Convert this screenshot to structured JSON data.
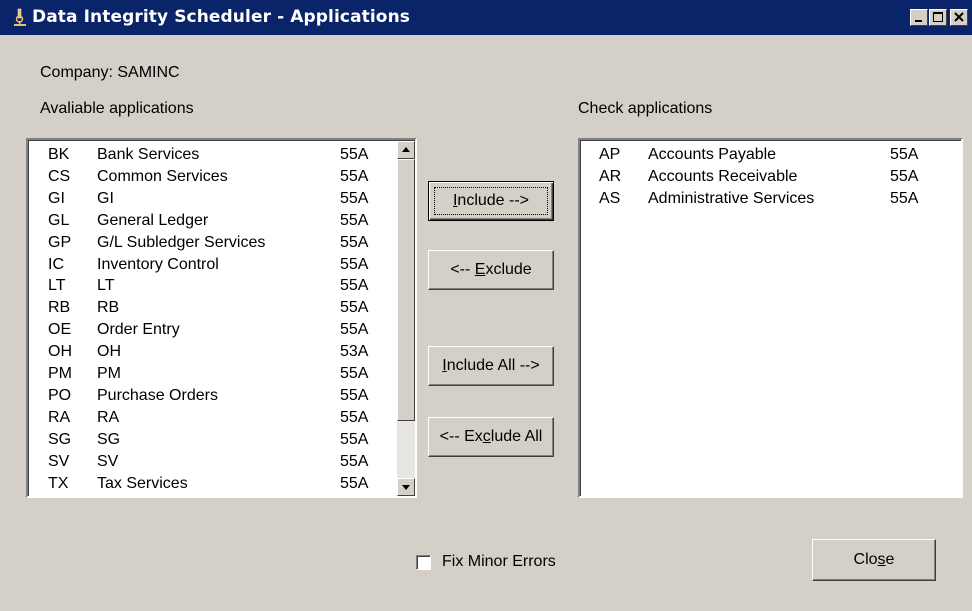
{
  "window": {
    "title": "Data Integrity Scheduler - Applications",
    "minimize_icon": "minimize-icon",
    "maximize_icon": "maximize-icon",
    "close_icon": "close-icon",
    "app_icon": "microscope-icon"
  },
  "company_label": "Company: SAMINC",
  "available": {
    "label": "Avaliable applications",
    "items": [
      {
        "code": "BK",
        "name": "Bank Services",
        "ver": "55A"
      },
      {
        "code": "CS",
        "name": "Common Services",
        "ver": "55A"
      },
      {
        "code": "GI",
        "name": "GI",
        "ver": "55A"
      },
      {
        "code": "GL",
        "name": "General Ledger",
        "ver": "55A"
      },
      {
        "code": "GP",
        "name": "G/L Subledger Services",
        "ver": "55A"
      },
      {
        "code": "IC",
        "name": "Inventory Control",
        "ver": "55A"
      },
      {
        "code": "LT",
        "name": "LT",
        "ver": "55A"
      },
      {
        "code": "RB",
        "name": "RB",
        "ver": "55A"
      },
      {
        "code": "OE",
        "name": "Order Entry",
        "ver": "55A"
      },
      {
        "code": "OH",
        "name": "OH",
        "ver": "53A"
      },
      {
        "code": "PM",
        "name": "PM",
        "ver": "55A"
      },
      {
        "code": "PO",
        "name": "Purchase Orders",
        "ver": "55A"
      },
      {
        "code": "RA",
        "name": "RA",
        "ver": "55A"
      },
      {
        "code": "SG",
        "name": "SG",
        "ver": "55A"
      },
      {
        "code": "SV",
        "name": "SV",
        "ver": "55A"
      },
      {
        "code": "TX",
        "name": "Tax Services",
        "ver": "55A"
      }
    ]
  },
  "check": {
    "label": "Check applications",
    "items": [
      {
        "code": "AP",
        "name": "Accounts Payable",
        "ver": "55A"
      },
      {
        "code": "AR",
        "name": "Accounts Receivable",
        "ver": "55A"
      },
      {
        "code": "AS",
        "name": "Administrative Services",
        "ver": "55A"
      }
    ]
  },
  "buttons": {
    "include": {
      "pre": "",
      "key": "I",
      "post": "nclude -->"
    },
    "exclude": {
      "pre": "<-- ",
      "key": "E",
      "post": "xclude"
    },
    "include_all": {
      "pre": "",
      "key": "I",
      "post": "nclude All -->"
    },
    "exclude_all": {
      "pre": "<-- Ex",
      "key": "c",
      "post": "lude All"
    },
    "close": {
      "pre": "Clo",
      "key": "s",
      "post": "e"
    }
  },
  "fix_minor_errors": {
    "label": "Fix Minor Errors",
    "checked": false
  }
}
